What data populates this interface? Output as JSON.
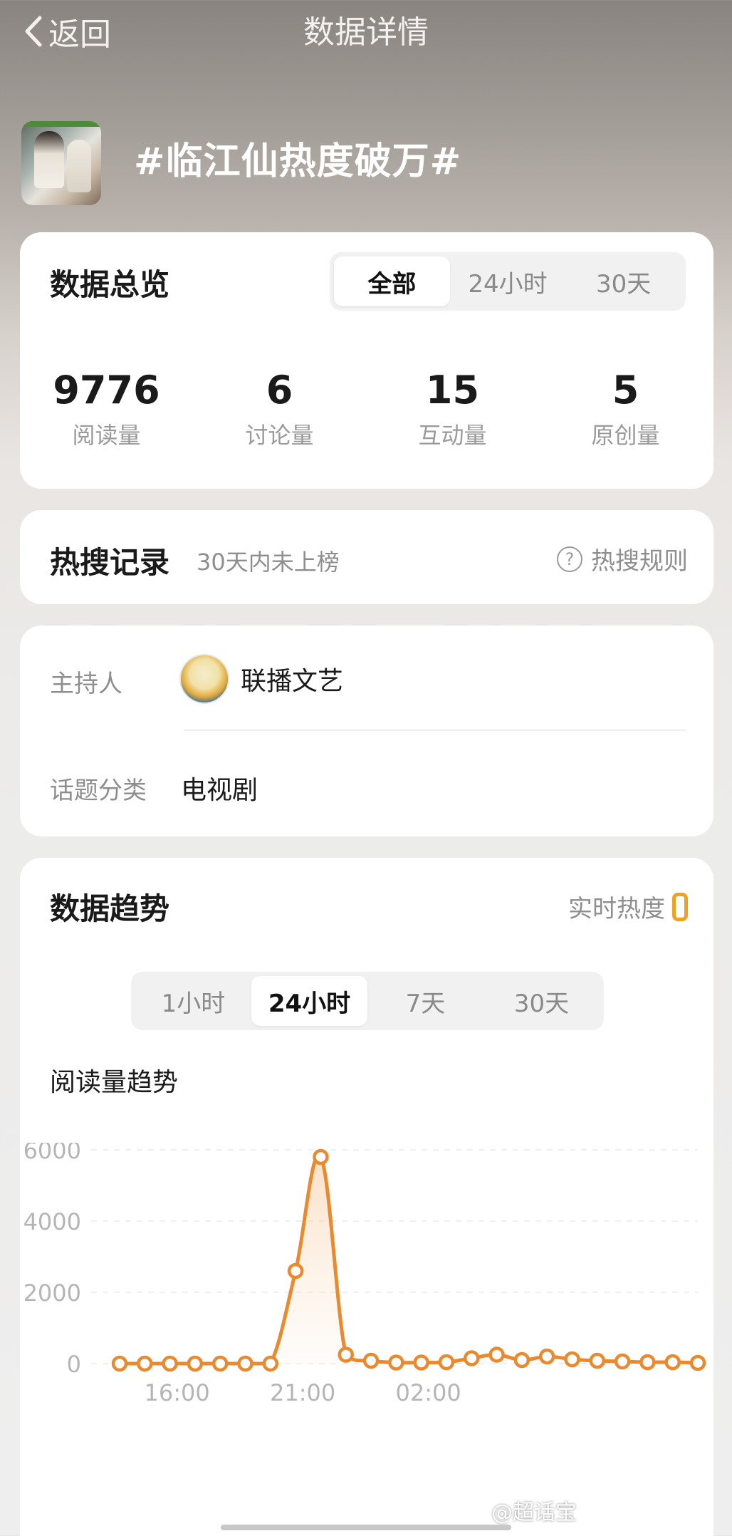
{
  "header": {
    "back_label": "返回",
    "title": "数据详情"
  },
  "topic": {
    "title": "#临江仙热度破万#"
  },
  "overview": {
    "title": "数据总览",
    "tabs": [
      "全部",
      "24小时",
      "30天"
    ],
    "active_tab": "全部",
    "stats": [
      {
        "value": "9776",
        "label": "阅读量"
      },
      {
        "value": "6",
        "label": "讨论量"
      },
      {
        "value": "15",
        "label": "互动量"
      },
      {
        "value": "5",
        "label": "原创量"
      }
    ]
  },
  "hot_search": {
    "title": "热搜记录",
    "subtitle": "30天内未上榜",
    "rule_label": "热搜规则"
  },
  "info": {
    "host_label": "主持人",
    "host_name": "联播文艺",
    "category_label": "话题分类",
    "category_value": "电视剧"
  },
  "trend": {
    "title": "数据趋势",
    "realtime_label": "实时热度",
    "tabs": [
      "1小时",
      "24小时",
      "7天",
      "30天"
    ],
    "active_tab": "24小时",
    "chart_title": "阅读量趋势"
  },
  "watermark": "@超话宝",
  "colors": {
    "accent": "#f0a21e",
    "line": "#e98a2e"
  },
  "chart_data": {
    "type": "area",
    "title": "阅读量趋势",
    "xlabel": "",
    "ylabel": "",
    "ylim": [
      0,
      6000
    ],
    "yticks": [
      0,
      2000,
      4000,
      6000
    ],
    "xticks": [
      "16:00",
      "21:00",
      "02:00"
    ],
    "x": [
      "14:00",
      "15:00",
      "16:00",
      "17:00",
      "18:00",
      "19:00",
      "20:00",
      "21:00",
      "22:00",
      "23:00",
      "00:00",
      "01:00",
      "02:00",
      "03:00",
      "04:00",
      "05:00",
      "06:00",
      "07:00",
      "08:00",
      "09:00",
      "10:00",
      "11:00",
      "12:00",
      "13:00"
    ],
    "series": [
      {
        "values": [
          0,
          0,
          0,
          0,
          0,
          0,
          0,
          2600,
          5800,
          250,
          80,
          30,
          30,
          40,
          150,
          250,
          100,
          200,
          120,
          80,
          60,
          40,
          40,
          20
        ]
      }
    ],
    "grid": true
  }
}
